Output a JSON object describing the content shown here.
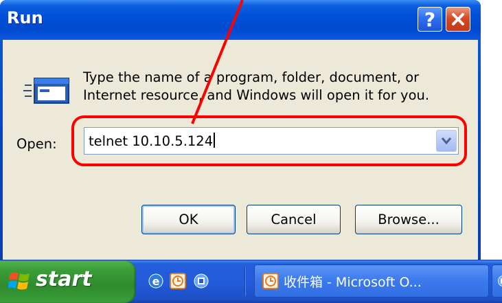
{
  "window": {
    "title": "Run",
    "help_label": "?",
    "close_icon": "close-icon"
  },
  "prompt": {
    "line1": "Type the name of a program, folder, document, or",
    "line2": "Internet resource, and Windows will open it for you."
  },
  "open_field": {
    "label": "Open:",
    "value": "telnet 10.10.5.124"
  },
  "buttons": {
    "ok": "OK",
    "cancel": "Cancel",
    "browse": "Browse..."
  },
  "taskbar": {
    "start_label": "start",
    "quick_launch": [
      "ie-icon",
      "clock-app-icon",
      "app-icon"
    ],
    "task_label": "收件箱 - Microsoft O..."
  },
  "colors": {
    "annotation": "#ff0000",
    "title_bar": "#0054e3",
    "dialog_bg": "#ece9d8",
    "taskbar": "#245edc",
    "start_green": "#3c9f3a"
  }
}
